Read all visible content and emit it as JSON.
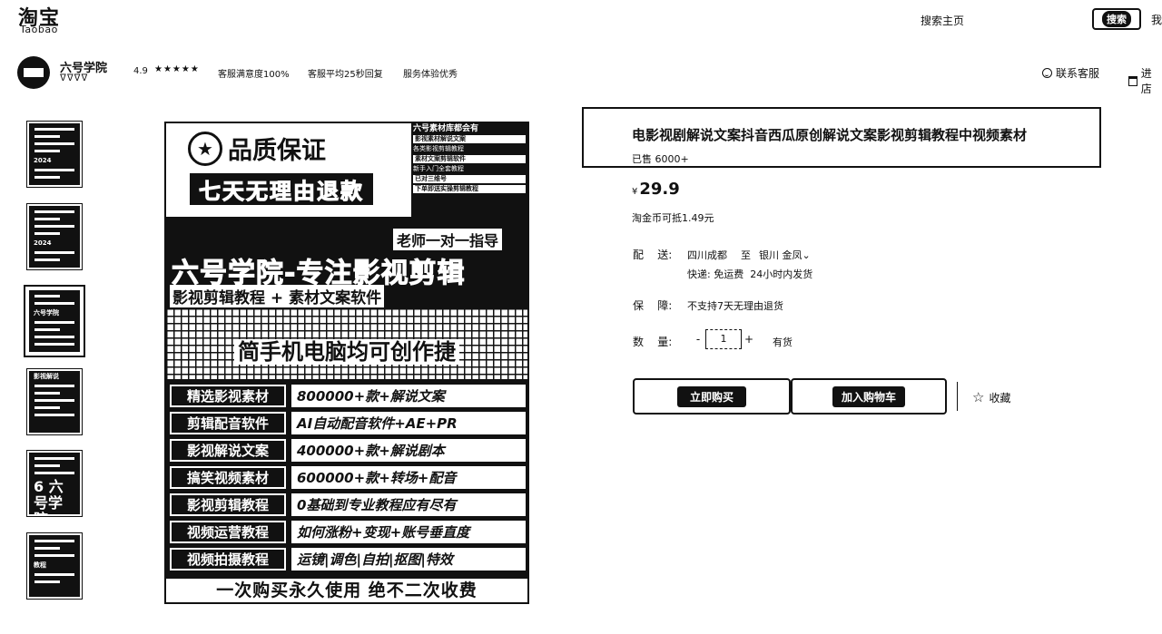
{
  "header": {
    "logo_cn": "淘宝",
    "logo_en": "Taobao",
    "search_home": "搜索主页",
    "search_button": "搜索",
    "cut_char": "我"
  },
  "shop": {
    "name": "六号学院",
    "level": "ᐁᐁᐁᐁ",
    "rating": "4.9",
    "stars": "★★★★★",
    "stats": [
      "客服满意度100%",
      "客服平均25秒回复",
      "服务体验优秀"
    ],
    "contact": "联系客服",
    "enter": "进店"
  },
  "thumbnails": [
    {
      "caption": "2024"
    },
    {
      "caption": "2024"
    },
    {
      "caption": "六号学院"
    },
    {
      "caption": "影视解说"
    },
    {
      "caption": "6 六号学院"
    },
    {
      "caption": "教程"
    }
  ],
  "main_image": {
    "title1": "品质保证",
    "title2": "七天无理由退款",
    "side_head": "六号素材库都会有",
    "side_lines": [
      "影视素材解说文案",
      "各类影视剪辑教程",
      "素材文案剪辑软件",
      "新手入门全套教程",
      "已对三维号",
      "下单即送实操剪辑教程"
    ],
    "teacher": "老师一对一指导",
    "brand": "六号学院-专注影视剪辑",
    "sub": "影视剪辑教程 + 素材文案软件",
    "slogan": "简手机电脑均可创作捷",
    "rows": [
      {
        "k": "精选影视素材",
        "v": "800000+款+解说文案"
      },
      {
        "k": "剪辑配音软件",
        "v": "AI自动配音软件+AE+PR"
      },
      {
        "k": "影视解说文案",
        "v": "400000+款+解说剧本"
      },
      {
        "k": "搞笑视频素材",
        "v": "600000+款+转场+配音"
      },
      {
        "k": "影视剪辑教程",
        "v": "0基础到专业教程应有尽有"
      },
      {
        "k": "视频运营教程",
        "v": "如何涨粉+变现+账号垂直度"
      },
      {
        "k": "视频拍摄教程",
        "v": "运镜|调色|自拍|抠图|特效"
      }
    ],
    "bottom": "一次购买永久使用 绝不二次收费"
  },
  "product": {
    "title": "电影视剧解说文案抖音西瓜原创解说文案影视剪辑教程中视频素材",
    "sold": "已售 6000+",
    "currency": "¥",
    "price": "29.9",
    "coin_note": "淘金币可抵1.49元",
    "delivery_label": "配    送:",
    "delivery_from": "四川成都",
    "delivery_to_word": "至",
    "delivery_to": "银川 金凤⌄",
    "shipping": "快递: 免运费  24小时内发货",
    "guarantee_label": "保    障:",
    "guarantee": "不支持7天无理由退货",
    "qty_label": "数    量:",
    "qty_minus": "-",
    "qty_value": "1",
    "qty_plus": "+",
    "stock": "有货",
    "buy_now": "立即购买",
    "add_cart": "加入购物车",
    "favorite": "收藏"
  }
}
